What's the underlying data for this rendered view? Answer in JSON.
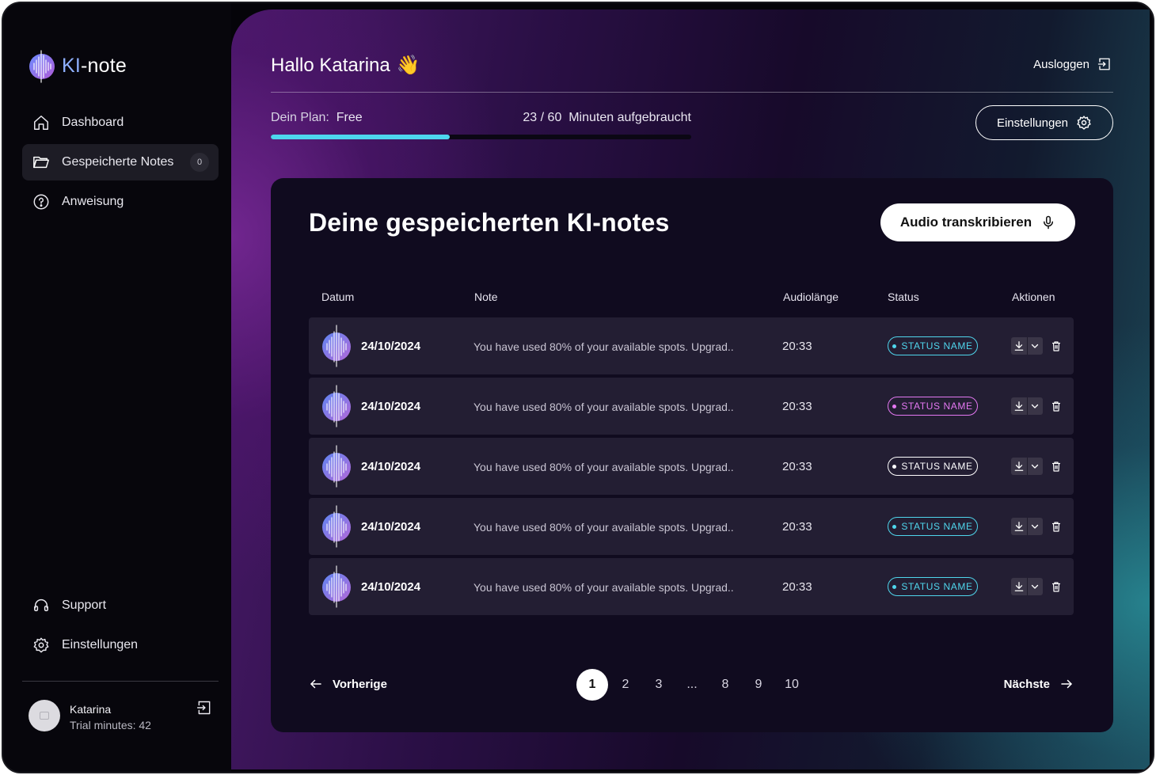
{
  "brand": {
    "prefix": "KI",
    "suffix": "-note"
  },
  "sidebar": {
    "top_items": [
      {
        "label": "Dashboard",
        "icon": "home-icon"
      },
      {
        "label": "Gespeicherte Notes",
        "icon": "folder-icon",
        "badge": "0",
        "active": true
      },
      {
        "label": "Anweisung",
        "icon": "help-circle-icon"
      }
    ],
    "bottom_items": [
      {
        "label": "Support",
        "icon": "headset-icon"
      },
      {
        "label": "Einstellungen",
        "icon": "gear-icon"
      }
    ],
    "user": {
      "name": "Katarina",
      "subtitle": "Trial minutes: 42"
    }
  },
  "header": {
    "greeting": "Hallo Katarina",
    "greeting_emoji": "👋",
    "logout_label": "Ausloggen",
    "plan_label": "Dein Plan:",
    "plan_value": "Free",
    "usage_text": "23 / 60  Minuten aufgebraucht",
    "usage_fraction": 0.425,
    "settings_label": "Einstellungen"
  },
  "notes": {
    "title": "Deine gespeicherten KI-notes",
    "transcribe_label": "Audio transkribieren",
    "columns": [
      "Datum",
      "Note",
      "Audiolänge",
      "Status",
      "Aktionen"
    ],
    "rows": [
      {
        "date": "24/10/2024",
        "note": "You have used 80% of your available spots. Upgrad..",
        "duration": "20:33",
        "status": "STATUS NAME",
        "status_color": "#4fd6ec"
      },
      {
        "date": "24/10/2024",
        "note": "You have used 80% of your available spots. Upgrad..",
        "duration": "20:33",
        "status": "STATUS NAME",
        "status_color": "#e478f2"
      },
      {
        "date": "24/10/2024",
        "note": "You have used 80% of your available spots. Upgrad..",
        "duration": "20:33",
        "status": "STATUS NAME",
        "status_color": "#ffffff"
      },
      {
        "date": "24/10/2024",
        "note": "You have used 80% of your available spots. Upgrad..",
        "duration": "20:33",
        "status": "STATUS NAME",
        "status_color": "#4fd6ec"
      },
      {
        "date": "24/10/2024",
        "note": "You have used 80% of your available spots. Upgrad..",
        "duration": "20:33",
        "status": "STATUS NAME",
        "status_color": "#4fd6ec"
      }
    ]
  },
  "pagination": {
    "prev_label": "Vorherige",
    "next_label": "Nächste",
    "pages": [
      "1",
      "2",
      "3",
      "...",
      "8",
      "9",
      "10"
    ],
    "current": "1"
  }
}
